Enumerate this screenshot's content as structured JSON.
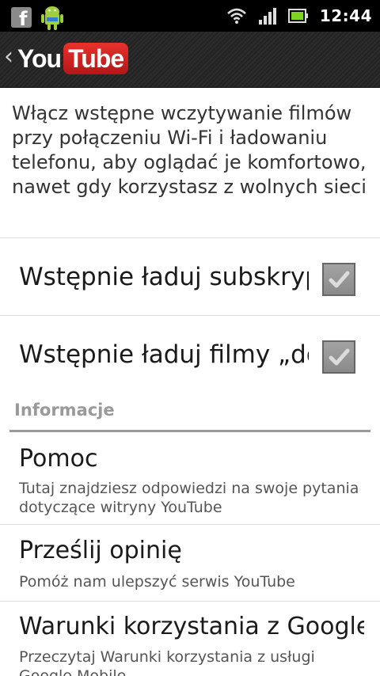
{
  "status_bar": {
    "time": "12:44",
    "colors": {
      "background": "#000000",
      "text": "#ffffff"
    }
  },
  "app_bar": {
    "back_glyph": "‹",
    "logo_you": "You",
    "logo_tube": "Tube",
    "colors": {
      "logo_red": "#d9231f"
    }
  },
  "description": "Włącz wstępne wczytywanie filmów przy połączeniu Wi-Fi i ładowaniu telefonu, aby oglądać je komfortowo, nawet gdy korzystasz z wolnych sieci",
  "preload_options": [
    {
      "label": "Wstępnie ładuj subskrypcje",
      "checked": true
    },
    {
      "label": "Wstępnie ładuj filmy „do obejrzenia”",
      "checked": true
    }
  ],
  "section": {
    "title": "Informacje"
  },
  "info_items": [
    {
      "title": "Pomoc",
      "subtitle": "Tutaj znajdziesz odpowiedzi na swoje pytania dotyczące witryny YouTube"
    },
    {
      "title": "Prześlij opinię",
      "subtitle": "Pomóż nam ulepszyć serwis YouTube"
    },
    {
      "title": "Warunki korzystania z Google Mobile",
      "subtitle": "Przeczytaj Warunki korzystania z usługi Google Mobile"
    }
  ]
}
